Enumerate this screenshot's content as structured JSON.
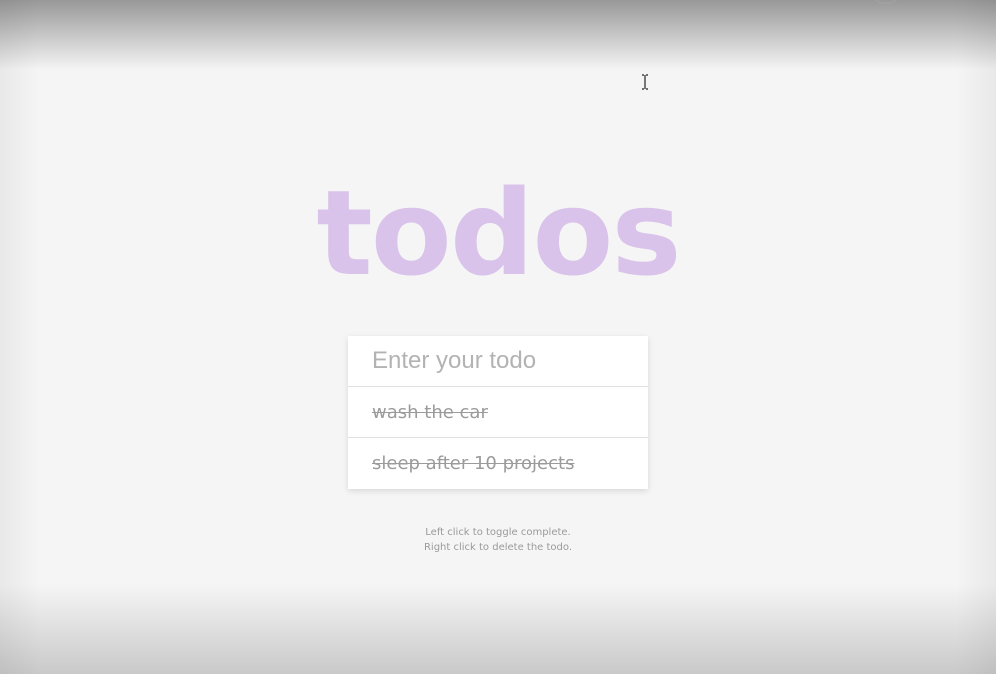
{
  "app": {
    "title": "todos"
  },
  "input": {
    "placeholder": "Enter your todo",
    "value": ""
  },
  "todos": [
    {
      "text": "wash the car",
      "completed": true
    },
    {
      "text": "sleep after 10 projects",
      "completed": true
    }
  ],
  "hints": {
    "line1": "Left click to toggle complete.",
    "line2": "Right click to delete the todo."
  },
  "colors": {
    "title": "#d9c3ea",
    "background": "#f5f5f5",
    "card": "#ffffff",
    "completed_text": "#9b9b9b"
  }
}
